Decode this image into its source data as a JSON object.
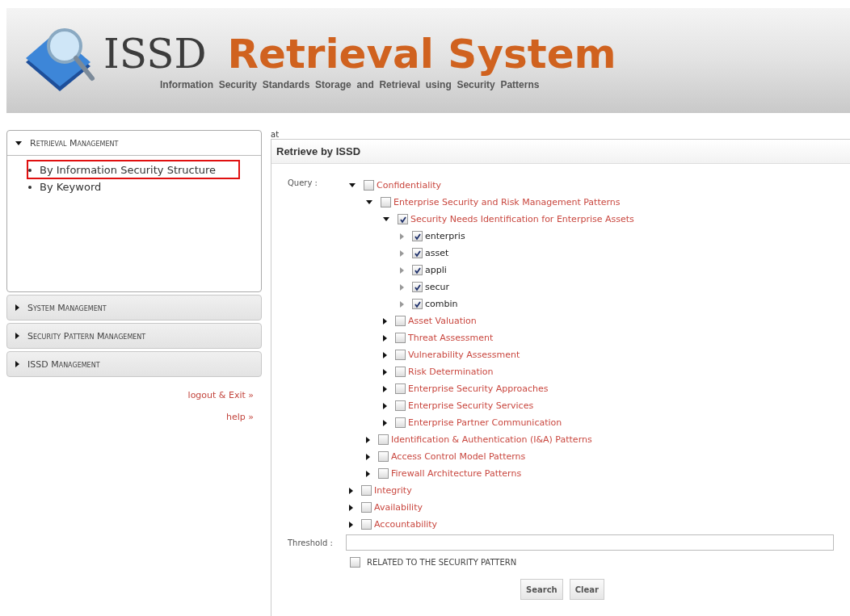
{
  "header": {
    "title_left": "ISSD",
    "title_right": "Retrieval System",
    "subtitle": "Information  Security  Standards  Storage  and  Retrieval  using  Security  Patterns"
  },
  "sidebar": {
    "sections": [
      {
        "title": "Retrieval Management",
        "expanded": true,
        "items": [
          {
            "label": "By Information Security Structure",
            "highlighted": true
          },
          {
            "label": "By Keyword",
            "highlighted": false
          }
        ]
      },
      {
        "title": "System Management",
        "expanded": false
      },
      {
        "title": "Security Pattern Management",
        "expanded": false
      },
      {
        "title": "ISSD Management",
        "expanded": false
      }
    ],
    "links": [
      "logout & Exit »",
      "help »"
    ]
  },
  "main": {
    "breadcrumb": "at",
    "panel_title": "Retrieve by ISSD",
    "query_label": "Query :",
    "tree": [
      {
        "kind": "category",
        "label": "Confidentiality",
        "checked": false,
        "expanded": true,
        "children": [
          {
            "kind": "category",
            "label": "Enterprise Security and Risk Management Patterns",
            "checked": false,
            "expanded": true,
            "children": [
              {
                "kind": "category",
                "label": "Security Needs Identification for Enterprise Assets",
                "checked": true,
                "expanded": true,
                "children": [
                  {
                    "kind": "term",
                    "label": "enterpris",
                    "checked": true,
                    "expanded": false
                  },
                  {
                    "kind": "term",
                    "label": "asset",
                    "checked": true,
                    "expanded": false
                  },
                  {
                    "kind": "term",
                    "label": "appli",
                    "checked": true,
                    "expanded": false
                  },
                  {
                    "kind": "term",
                    "label": "secur",
                    "checked": true,
                    "expanded": false
                  },
                  {
                    "kind": "term",
                    "label": "combin",
                    "checked": true,
                    "expanded": false
                  }
                ]
              },
              {
                "kind": "category",
                "label": "Asset Valuation",
                "checked": false,
                "expanded": false
              },
              {
                "kind": "category",
                "label": "Threat Assessment",
                "checked": false,
                "expanded": false
              },
              {
                "kind": "category",
                "label": "Vulnerability Assessment",
                "checked": false,
                "expanded": false
              },
              {
                "kind": "category",
                "label": "Risk Determination",
                "checked": false,
                "expanded": false
              },
              {
                "kind": "category",
                "label": "Enterprise Security Approaches",
                "checked": false,
                "expanded": false
              },
              {
                "kind": "category",
                "label": "Enterprise Security Services",
                "checked": false,
                "expanded": false
              },
              {
                "kind": "category",
                "label": "Enterprise Partner Communication",
                "checked": false,
                "expanded": false
              }
            ]
          },
          {
            "kind": "category",
            "label": "Identification & Authentication (I&A) Patterns",
            "checked": false,
            "expanded": false
          },
          {
            "kind": "category",
            "label": "Access Control Model Patterns",
            "checked": false,
            "expanded": false
          },
          {
            "kind": "category",
            "label": "Firewall Architecture Patterns",
            "checked": false,
            "expanded": false
          }
        ]
      },
      {
        "kind": "category",
        "label": "Integrity",
        "checked": false,
        "expanded": false
      },
      {
        "kind": "category",
        "label": "Availability",
        "checked": false,
        "expanded": false
      },
      {
        "kind": "category",
        "label": "Accountability",
        "checked": false,
        "expanded": false
      }
    ],
    "threshold_label": "Threshold :",
    "related": {
      "label": "RELATED TO THE SECURITY PATTERN",
      "checked": false
    },
    "buttons": [
      "Search",
      "Clear"
    ]
  }
}
